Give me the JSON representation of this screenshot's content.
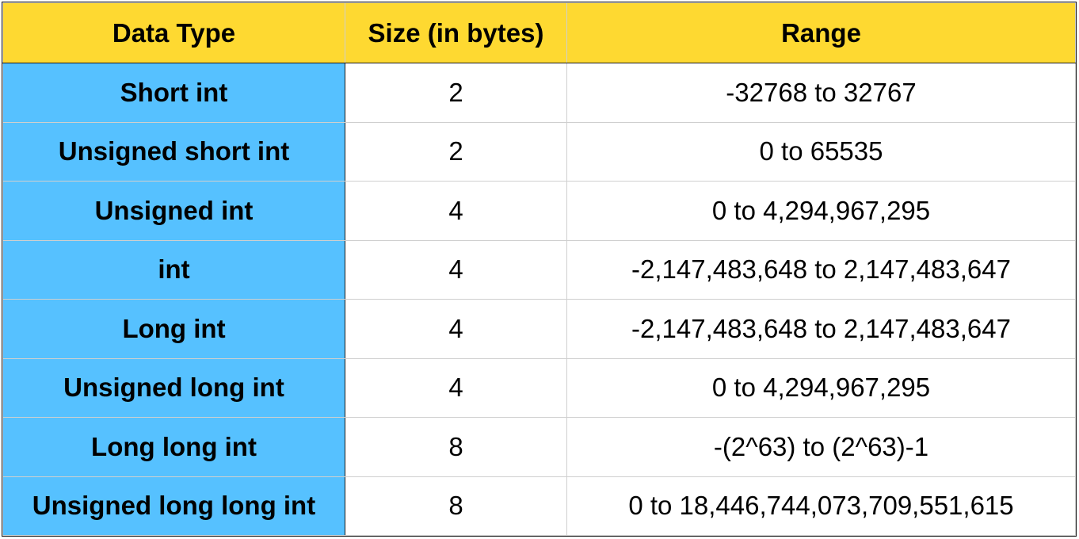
{
  "headers": [
    "Data Type",
    "Size (in bytes)",
    "Range"
  ],
  "rows": [
    {
      "type": "Short int",
      "size": "2",
      "range": "-32768 to 32767"
    },
    {
      "type": "Unsigned short int",
      "size": "2",
      "range": "0 to 65535"
    },
    {
      "type": "Unsigned int",
      "size": "4",
      "range": "0 to 4,294,967,295"
    },
    {
      "type": "int",
      "size": "4",
      "range": "-2,147,483,648 to 2,147,483,647"
    },
    {
      "type": "Long int",
      "size": "4",
      "range": "-2,147,483,648 to 2,147,483,647"
    },
    {
      "type": "Unsigned long int",
      "size": "4",
      "range": "0 to 4,294,967,295"
    },
    {
      "type": "Long long int",
      "size": "8",
      "range": "-(2^63) to (2^63)-1"
    },
    {
      "type": "Unsigned long long int",
      "size": "8",
      "range": "0 to 18,446,744,073,709,551,615"
    }
  ],
  "colors": {
    "header_bg": "#fed931",
    "type_column_bg": "#56c1ff",
    "cell_bg": "#ffffff"
  }
}
